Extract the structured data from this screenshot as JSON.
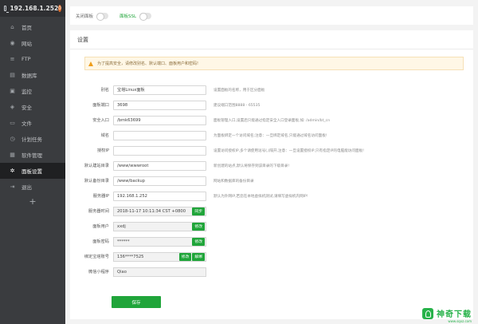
{
  "sidebar": {
    "server_ip": "192.168.1.252",
    "badge": "0",
    "items": [
      {
        "label": "首页",
        "icon": "home-icon",
        "glyph": "⌂"
      },
      {
        "label": "网站",
        "icon": "globe-icon",
        "glyph": "◉"
      },
      {
        "label": "FTP",
        "icon": "ftp-icon",
        "glyph": "≡"
      },
      {
        "label": "数据库",
        "icon": "database-icon",
        "glyph": "▤"
      },
      {
        "label": "监控",
        "icon": "monitor-icon",
        "glyph": "▣"
      },
      {
        "label": "安全",
        "icon": "shield-icon",
        "glyph": "◈"
      },
      {
        "label": "文件",
        "icon": "folder-icon",
        "glyph": "▭"
      },
      {
        "label": "计划任务",
        "icon": "clock-icon",
        "glyph": "◷"
      },
      {
        "label": "软件管理",
        "icon": "apps-icon",
        "glyph": "▦"
      },
      {
        "label": "面板设置",
        "icon": "gear-icon",
        "glyph": "✲",
        "active": true
      },
      {
        "label": "退出",
        "icon": "logout-icon",
        "glyph": "⇥"
      }
    ],
    "add_label": "+"
  },
  "toggles": {
    "close_panel": "关闭面板",
    "panel_ssl": "面板SSL"
  },
  "panel": {
    "title": "设置",
    "notice": "为了提高安全，请修改别名、默认端口、面板用户和密码!",
    "fields": [
      {
        "label": "别名",
        "value": "宝塔Linux面板",
        "tip": "设置面板的名称，用于区分面板",
        "type": "input"
      },
      {
        "label": "面板端口",
        "value": "3698",
        "tip": "建议端口范围8888 - 65535",
        "type": "input"
      },
      {
        "label": "安全入口",
        "value": "/bmk63699",
        "tip": "面板管理入口,设置后只能通过指定安全入口登录面板,如: /admin/bt_cn",
        "type": "input"
      },
      {
        "label": "域名",
        "value": "",
        "tip": "为面板绑定一个访问域名;注意：一旦绑定域名,只能通过域名访问面板!",
        "type": "input"
      },
      {
        "label": "授权IP",
        "value": "",
        "tip": "设置访问授权IP,多个请使用逗号(,)隔开,注意：一旦设置授权IP,只有指定IP的电脑能访问面板!",
        "type": "input"
      },
      {
        "label": "默认建站目录",
        "value": "/www/wwwroot",
        "tip": "新创建的站点,默认将保存到该目录的下级目录!",
        "type": "input"
      },
      {
        "label": "默认备份目录",
        "value": "/www/backup",
        "tip": "网站和数据库的备份目录",
        "type": "input"
      },
      {
        "label": "服务器IP",
        "value": "192.168.1.252",
        "tip": "默认为外网IP,若您在本地虚拟机测试,请填写虚拟机内网IP!",
        "type": "input"
      },
      {
        "label": "服务器时间",
        "value": "2018-11-17 10:11:34 CST +0800",
        "tip": "",
        "type": "readonly",
        "buttons": [
          "同步"
        ]
      },
      {
        "label": "面板用户",
        "value": "xxdj",
        "tip": "",
        "type": "readonly",
        "buttons": [
          "修改"
        ]
      },
      {
        "label": "面板密码",
        "value": "******",
        "tip": "",
        "type": "readonly",
        "buttons": [
          "修改"
        ]
      },
      {
        "label": "绑定宝塔账号",
        "value": "136****7525",
        "tip": "",
        "type": "readonly",
        "buttons": [
          "修改",
          "解绑"
        ]
      },
      {
        "label": "微信小程序",
        "value": "Qiao",
        "tip": "",
        "type": "readonly",
        "buttons": []
      }
    ],
    "save_label": "保存"
  },
  "watermark": {
    "brand": "神奇下载",
    "sub": "www.sqxz.com"
  },
  "colors": {
    "accent": "#20a53a",
    "sidebar_bg": "#3a3c3f",
    "notice_bg": "#fff7e6"
  }
}
